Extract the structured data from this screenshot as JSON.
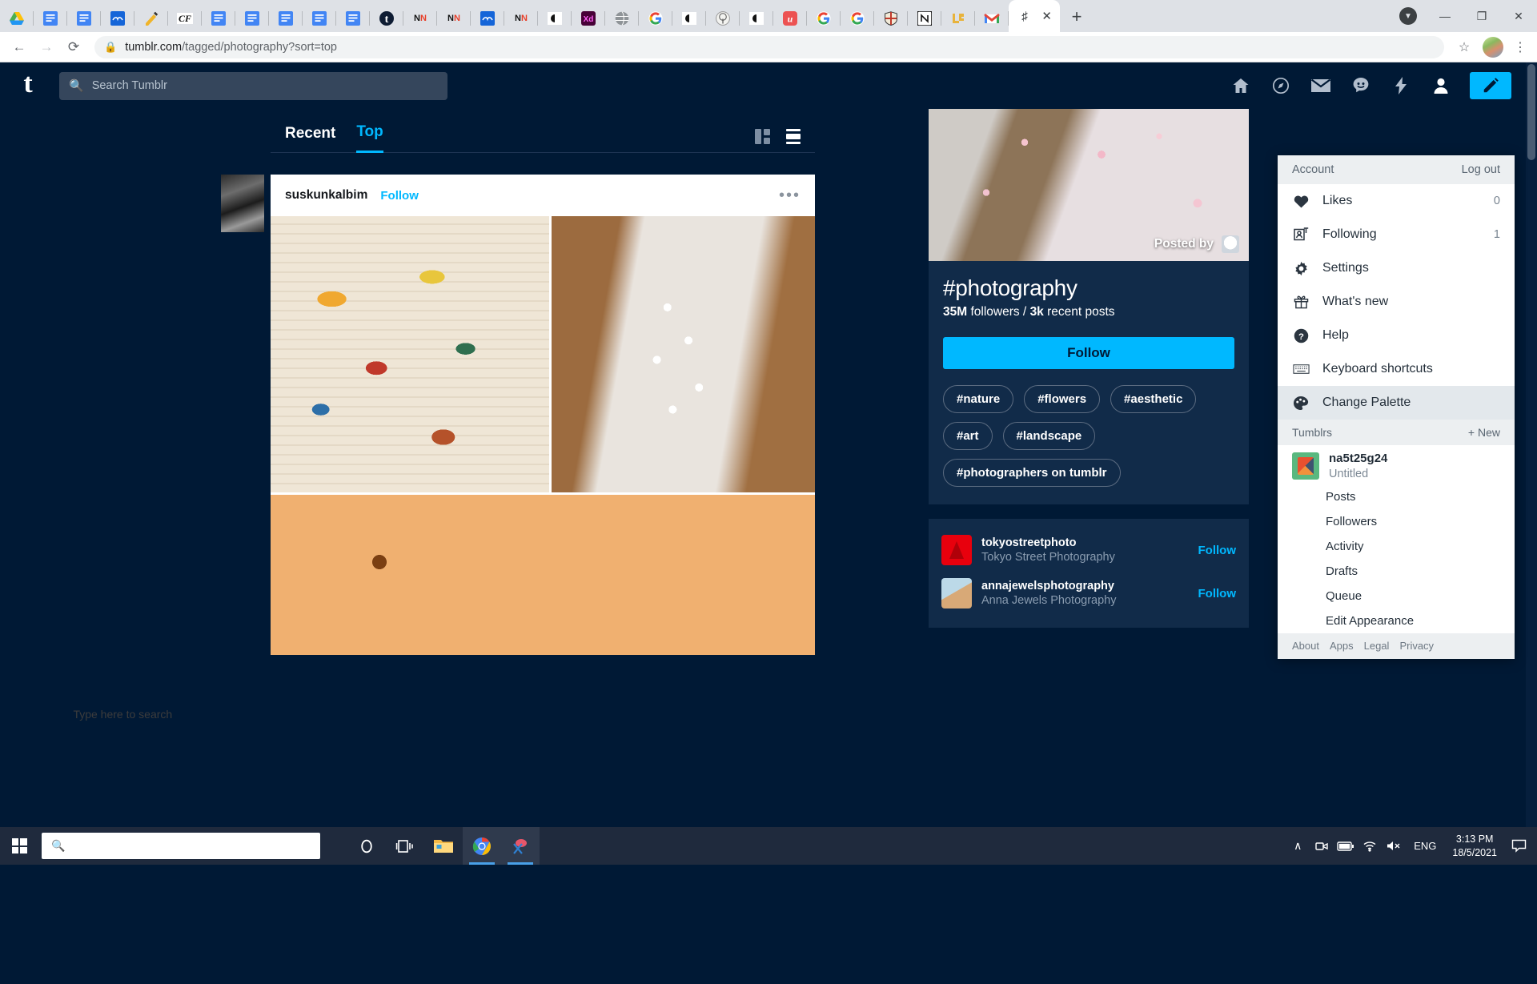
{
  "browser": {
    "tabs": [
      {
        "icon": "google-drive-icon",
        "kind": "drive"
      },
      {
        "icon": "docs-icon",
        "kind": "docs"
      },
      {
        "icon": "docs-icon",
        "kind": "docs"
      },
      {
        "icon": "cloud-icon",
        "kind": "cloud"
      },
      {
        "icon": "pen-icon",
        "kind": "pen"
      },
      {
        "icon": "cf-icon",
        "kind": "cf",
        "label": "CF"
      },
      {
        "icon": "docs-icon",
        "kind": "docs"
      },
      {
        "icon": "docs-icon",
        "kind": "docs"
      },
      {
        "icon": "docs-icon",
        "kind": "docs"
      },
      {
        "icon": "docs-icon",
        "kind": "docs"
      },
      {
        "icon": "docs-icon",
        "kind": "docs"
      },
      {
        "icon": "tumblr-icon",
        "kind": "tumblr",
        "label": "t"
      },
      {
        "icon": "nn-icon",
        "kind": "nn",
        "label": "NN"
      },
      {
        "icon": "nn-icon",
        "kind": "nn",
        "label": "NN"
      },
      {
        "icon": "cloud-icon",
        "kind": "cloud"
      },
      {
        "icon": "nn-icon",
        "kind": "nn",
        "label": "NN"
      },
      {
        "icon": "moon-icon",
        "kind": "moon"
      },
      {
        "icon": "adobe-xd-icon",
        "kind": "xd",
        "label": "Xd"
      },
      {
        "icon": "globe-icon",
        "kind": "globe"
      },
      {
        "icon": "google-icon",
        "kind": "google"
      },
      {
        "icon": "moon-icon",
        "kind": "moon"
      },
      {
        "icon": "tree-icon",
        "kind": "tree"
      },
      {
        "icon": "moon-icon",
        "kind": "moon"
      },
      {
        "icon": "udemy-icon",
        "kind": "udemy",
        "label": "u"
      },
      {
        "icon": "google-icon",
        "kind": "google"
      },
      {
        "icon": "google-icon",
        "kind": "google"
      },
      {
        "icon": "shield-icon",
        "kind": "shield"
      },
      {
        "icon": "notion-icon",
        "kind": "notion",
        "label": "N"
      },
      {
        "icon": "lr-icon",
        "kind": "lr"
      },
      {
        "icon": "gmail-icon",
        "kind": "gmail",
        "label": "M"
      }
    ],
    "active_tab": {
      "icon": "tumblr-tag-icon",
      "label": "#",
      "close_label": "✕"
    },
    "new_tab_label": "+",
    "window_controls": {
      "minimize": "—",
      "maximize": "❐",
      "close": "✕",
      "tab_search": "▼"
    },
    "toolbar": {
      "back": "←",
      "forward": "→",
      "reload": "⟳",
      "lock_icon": "lock-icon",
      "url_host": "tumblr.com",
      "url_path": "/tagged/photography?sort=top",
      "bookmark_star": "☆",
      "menu_kebab": "⋮"
    }
  },
  "tumblr": {
    "logo_letter": "t",
    "search": {
      "placeholder": "Search Tumblr",
      "value": ""
    },
    "nav_icons": [
      "home-icon",
      "explore-icon",
      "messages-icon",
      "activity-icon",
      "shortcuts-icon",
      "account-icon"
    ],
    "compose_label": "compose-icon",
    "feed": {
      "tabs": [
        {
          "label": "Recent",
          "active": false
        },
        {
          "label": "Top",
          "active": true
        }
      ],
      "view_modes": [
        "grid-view-icon",
        "list-view-icon"
      ],
      "post": {
        "username": "suskunkalbim",
        "follow_label": "Follow",
        "more_label": "•••"
      }
    },
    "tag": {
      "name": "#photography",
      "followers": "35M",
      "followers_label": "followers /",
      "recent_posts": "3k",
      "recent_posts_label": "recent posts",
      "follow_label": "Follow",
      "posted_by_label": "Posted by",
      "related_tags": [
        "#nature",
        "#flowers",
        "#aesthetic",
        "#art",
        "#landscape",
        "#photographers on tumblr"
      ]
    },
    "suggested_blogs": [
      {
        "name": "tokyostreetphoto",
        "title": "Tokyo Street Photography",
        "follow_label": "Follow",
        "avatar": "tokyo-tower-avatar"
      },
      {
        "name": "annajewelsphotography",
        "title": "Anna Jewels Photography",
        "follow_label": "Follow",
        "avatar": "photo-avatar"
      }
    ],
    "account_menu": {
      "header": {
        "title": "Account",
        "logout_label": "Log out"
      },
      "items": [
        {
          "label": "Likes",
          "icon": "heart-icon",
          "count": "0",
          "highlight": false
        },
        {
          "label": "Following",
          "icon": "add-person-icon",
          "count": "1",
          "highlight": false
        },
        {
          "label": "Settings",
          "icon": "gear-icon",
          "count": "",
          "highlight": false
        },
        {
          "label": "What's new",
          "icon": "gift-icon",
          "count": "",
          "highlight": false
        },
        {
          "label": "Help",
          "icon": "help-icon",
          "count": "",
          "highlight": false
        },
        {
          "label": "Keyboard shortcuts",
          "icon": "keyboard-icon",
          "count": "",
          "highlight": false
        },
        {
          "label": "Change Palette",
          "icon": "palette-icon",
          "count": "",
          "highlight": true
        }
      ],
      "tumblrs_header": {
        "title": "Tumblrs",
        "new_label": "+ New"
      },
      "blog": {
        "name": "na5t25g24",
        "subtitle": "Untitled",
        "avatar": "cube-avatar"
      },
      "blog_links": [
        "Posts",
        "Followers",
        "Activity",
        "Drafts",
        "Queue",
        "Edit Appearance"
      ],
      "footer_links": [
        "About",
        "Apps",
        "Legal",
        "Privacy"
      ]
    }
  },
  "taskbar": {
    "start_label": "start-icon",
    "search_placeholder": "Type here to search",
    "pinned": [
      "cortana-icon",
      "task-view-icon",
      "file-explorer-icon",
      "chrome-icon",
      "snipping-tool-icon"
    ],
    "tray": {
      "overflow": "∧",
      "icons": [
        "camera-icon",
        "battery-icon",
        "wifi-icon",
        "volume-muted-icon"
      ],
      "language": "ENG",
      "time": "3:13 PM",
      "date": "18/5/2021",
      "notification": "notification-icon"
    }
  }
}
